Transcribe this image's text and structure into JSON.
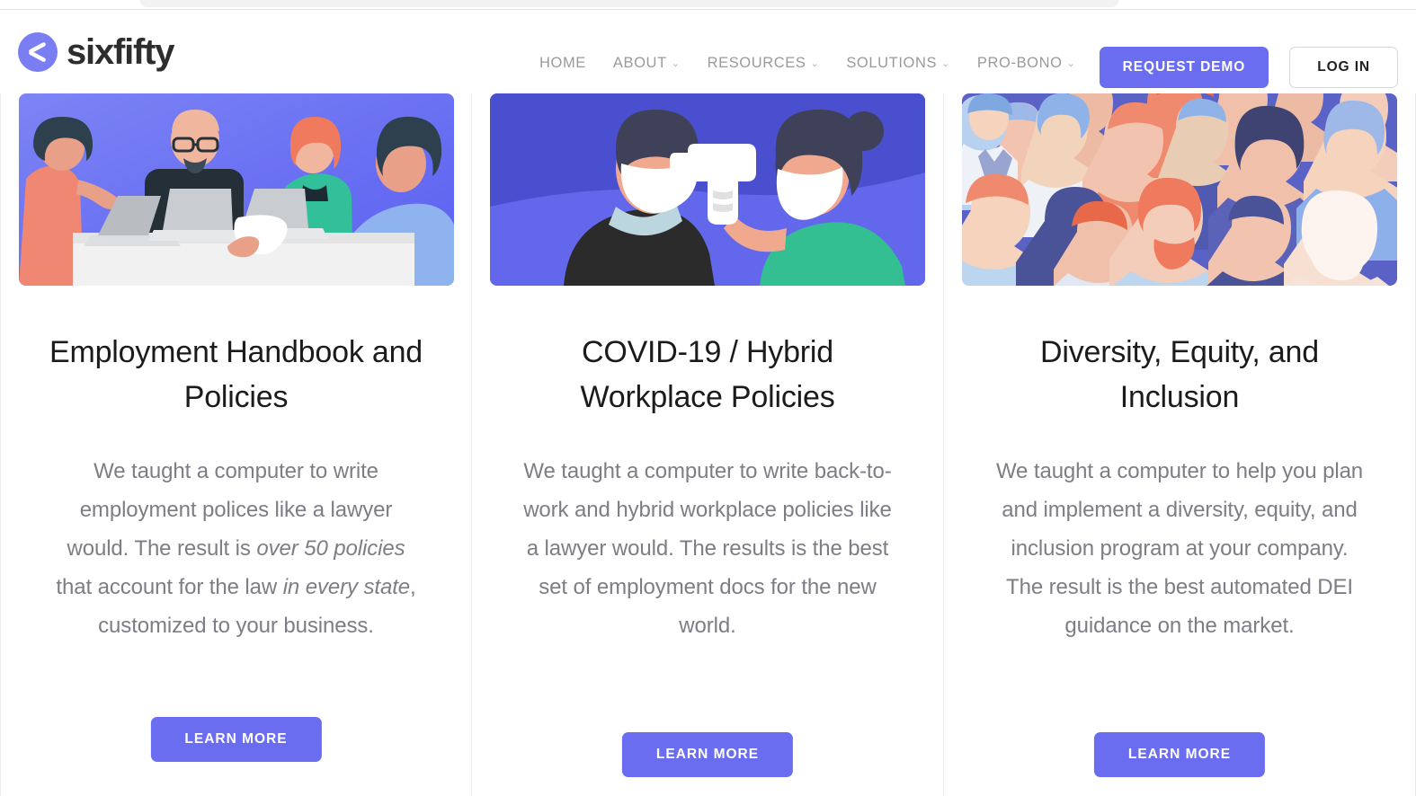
{
  "brand": {
    "name": "sixfifty",
    "logo_icon": "chevron-left-logo-icon",
    "logo_color": "#7b7ef2"
  },
  "header": {
    "nav": [
      {
        "label": "HOME",
        "has_dropdown": false
      },
      {
        "label": "ABOUT",
        "has_dropdown": true
      },
      {
        "label": "RESOURCES",
        "has_dropdown": true
      },
      {
        "label": "SOLUTIONS",
        "has_dropdown": true
      },
      {
        "label": "PRO-BONO",
        "has_dropdown": true
      }
    ],
    "caret_glyph": "⌄",
    "request_demo_label": "REQUEST DEMO",
    "login_label": "LOG IN",
    "accent_color": "#6b6df0"
  },
  "cards": [
    {
      "title": "Employment Handbook and Policies",
      "body_part_1": "We taught a computer to write employment polices like a lawyer would. The result is ",
      "body_em_1": "over 50 policies",
      "body_part_2": " that account for the law ",
      "body_em_2": "in every state",
      "body_part_3": ", customized to your business.",
      "cta_label": "LEARN MORE",
      "image_alt": "illustration-business-meeting-laptops"
    },
    {
      "title": "COVID-19 / Hybrid Workplace Policies",
      "body_part_1": "We taught a computer to write back-to-work and hybrid workplace policies like a lawyer would. The results is the best set of employment docs for the new world.",
      "body_em_1": "",
      "body_part_2": "",
      "body_em_2": "",
      "body_part_3": "",
      "cta_label": "LEARN MORE",
      "image_alt": "illustration-masked-temperature-check"
    },
    {
      "title": "Diversity, Equity, and Inclusion",
      "body_part_1": "We taught a computer to help you plan and implement a diversity, equity, and inclusion program at your company. The result is the best automated DEI guidance on the market.",
      "body_em_1": "",
      "body_part_2": "",
      "body_em_2": "",
      "body_part_3": "",
      "cta_label": "LEARN MORE",
      "image_alt": "illustration-diverse-crowd"
    }
  ]
}
